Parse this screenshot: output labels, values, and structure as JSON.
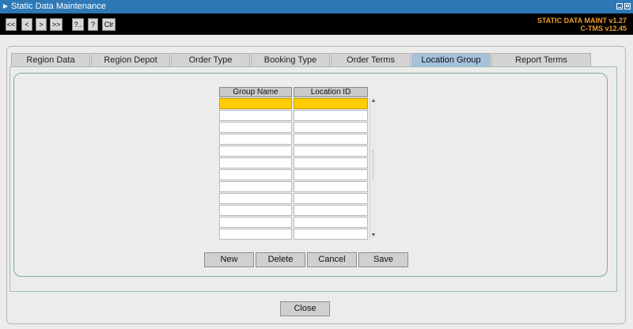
{
  "window": {
    "title": "Static Data Maintenance"
  },
  "toolbar": {
    "buttons": [
      {
        "label": "<<"
      },
      {
        "label": "<"
      },
      {
        "label": ">"
      },
      {
        "label": ">>"
      },
      {
        "label": "?.."
      },
      {
        "label": "?"
      },
      {
        "label": "Clr"
      }
    ],
    "version_line1": "STATIC DATA MAINT v1.27",
    "version_line2": "C-TMS v12.45"
  },
  "tabs": [
    {
      "label": "Region Data"
    },
    {
      "label": "Region Depot"
    },
    {
      "label": "Order Type"
    },
    {
      "label": "Booking Type"
    },
    {
      "label": "Order Terms"
    },
    {
      "label": "Location Group Name",
      "active": true
    },
    {
      "label": "Report Terms Configuration"
    }
  ],
  "grid": {
    "columns": [
      {
        "label": "Group Name"
      },
      {
        "label": "Location ID"
      }
    ],
    "visible_rows": 12,
    "selected_row": 1
  },
  "actions": {
    "new": "New",
    "delete": "Delete",
    "cancel": "Cancel",
    "save": "Save"
  },
  "footer": {
    "close": "Close"
  },
  "colors": {
    "titlebar": "#2e78b6",
    "toolbar_bg": "#000000",
    "version_text": "#f29a2e",
    "active_tab": "#a6c1dc",
    "selected_row": "#ffcc00"
  }
}
